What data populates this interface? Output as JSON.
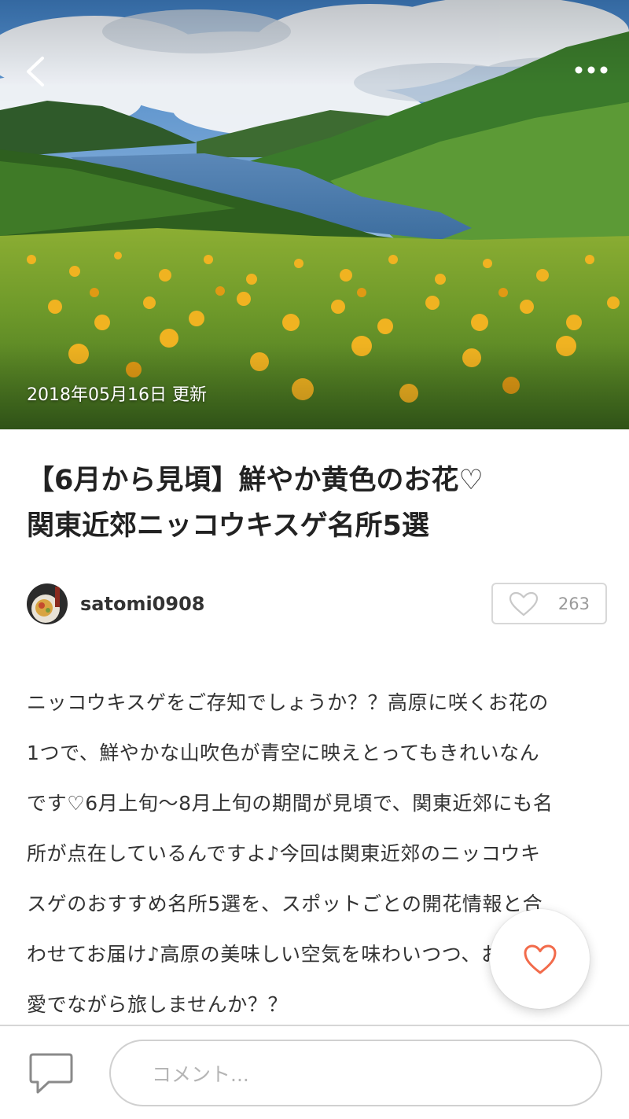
{
  "hero": {
    "updated_date": "2018年05月16日 更新",
    "back_icon": "chevron-left-icon",
    "more_icon": "more-dots-icon"
  },
  "article": {
    "title_lines": [
      "【6月から見頃】鮮やか黄色のお花♡",
      "関東近郊ニッコウキスゲ名所5選"
    ],
    "author": {
      "name": "satomi0908"
    },
    "likes": "263",
    "body_lines": [
      "ニッコウキスゲをご存知でしょうか？？高原に咲くお花の",
      "1つで、鮮やかな山吹色が青空に映えとってもきれいなん",
      "です♡6月上旬〜8月上旬の期間が見頃で、関東近郊にも名",
      "所が点在しているんですよ♪今回は関東近郊のニッコウキ",
      "スゲのおすすめ名所5選を、スポットごとの開花情報と合",
      "わせてお届け♪高原の美味しい空気を味わいつつ、お花を",
      "愛でながら旅しませんか？？"
    ]
  },
  "comment_bar": {
    "placeholder": "コメント..."
  },
  "colors": {
    "accent": "#f26b4b",
    "text": "#333333",
    "muted": "#9a9a9a",
    "border": "#d8d8d8"
  }
}
